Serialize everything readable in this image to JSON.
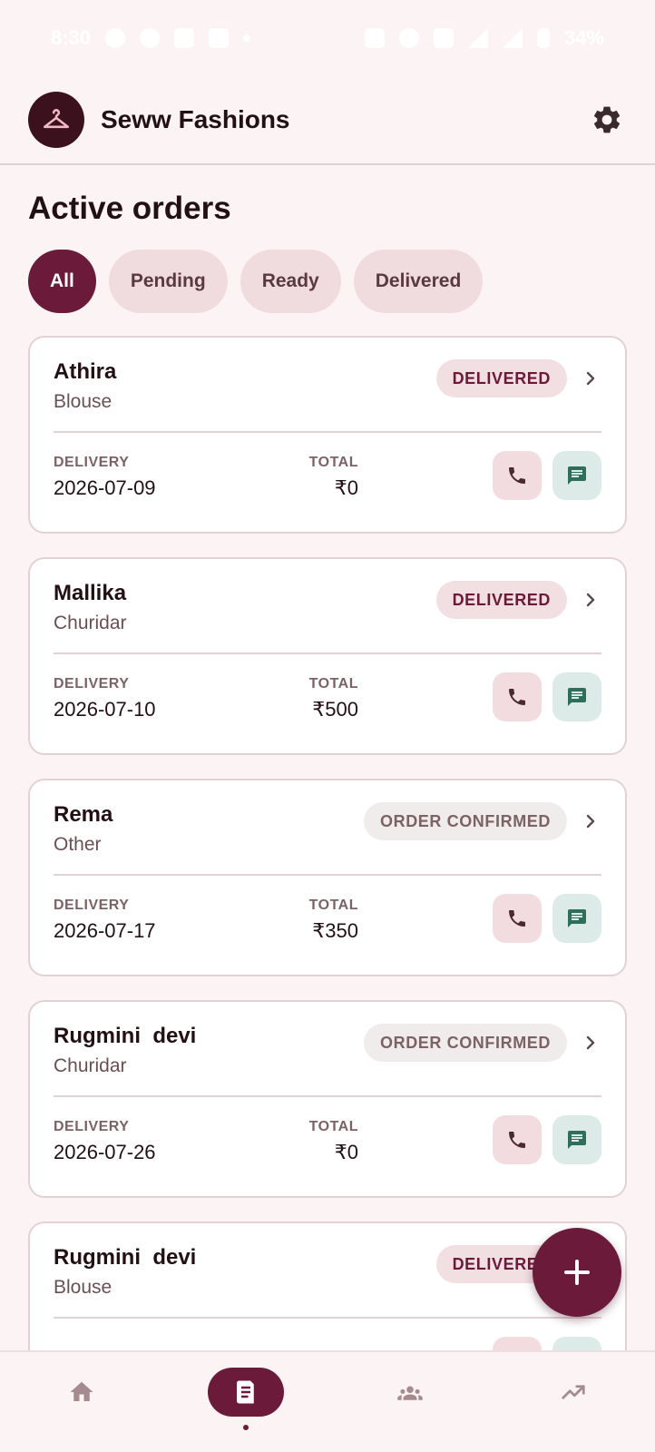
{
  "status_bar": {
    "time": "8:30",
    "battery": "34%"
  },
  "app": {
    "title": "Seww Fashions"
  },
  "page": {
    "title": "Active orders"
  },
  "filters": [
    {
      "label": "All",
      "selected": true
    },
    {
      "label": "Pending",
      "selected": false
    },
    {
      "label": "Ready",
      "selected": false
    },
    {
      "label": "Delivered",
      "selected": false
    }
  ],
  "labels": {
    "delivery": "DELIVERY",
    "total": "TOTAL"
  },
  "orders": [
    {
      "customer": "Athira",
      "garment": "Blouse",
      "status": "DELIVERED",
      "status_type": "delivered",
      "delivery_date": "2026-07-09",
      "total": "₹0"
    },
    {
      "customer": "Mallika",
      "garment": "Churidar",
      "status": "DELIVERED",
      "status_type": "delivered",
      "delivery_date": "2026-07-10",
      "total": "₹500"
    },
    {
      "customer": "Rema",
      "garment": "Other",
      "status": "ORDER CONFIRMED",
      "status_type": "confirmed",
      "delivery_date": "2026-07-17",
      "total": "₹350"
    },
    {
      "customer": "Rugmini  devi",
      "garment": "Churidar",
      "status": "ORDER CONFIRMED",
      "status_type": "confirmed",
      "delivery_date": "2026-07-26",
      "total": "₹0"
    },
    {
      "customer": "Rugmini  devi",
      "garment": "Blouse",
      "status": "DELIVERED",
      "status_type": "delivered",
      "delivery_date": "",
      "total": ""
    }
  ],
  "bottom_nav": [
    {
      "icon": "home-icon",
      "active": false
    },
    {
      "icon": "orders-icon",
      "active": true
    },
    {
      "icon": "customers-icon",
      "active": false
    },
    {
      "icon": "analytics-icon",
      "active": false
    }
  ],
  "colors": {
    "primary": "#6b1a3a",
    "background": "#fcf4f4",
    "delivered_badge_bg": "#f1dfe2",
    "confirmed_badge_bg": "#f1ecec",
    "call_button_bg": "#f2dcdf",
    "message_button_bg": "#dcebe7"
  }
}
